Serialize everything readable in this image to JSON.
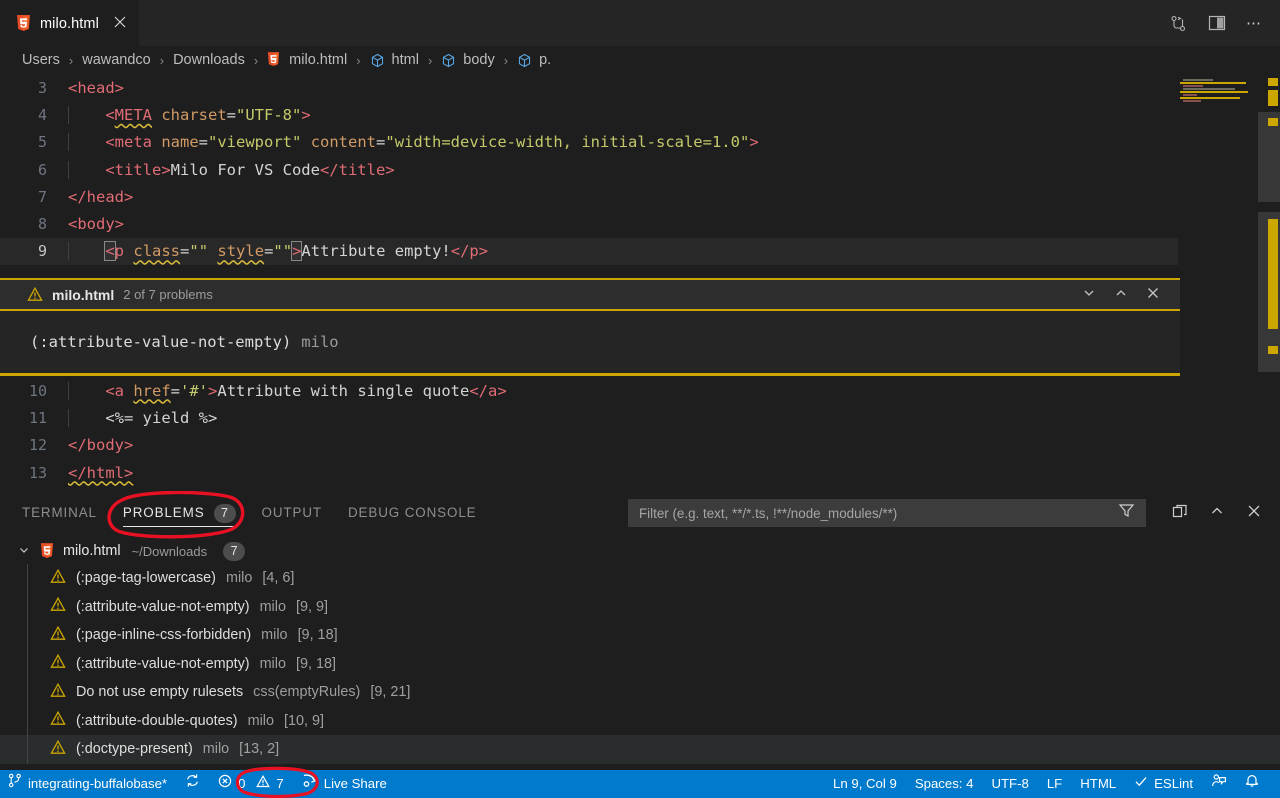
{
  "window": {
    "tab": {
      "label": "milo.html",
      "icon": "html5-icon",
      "close_icon": "close-icon"
    },
    "actions": [
      "source-control-icon",
      "split-editor-icon",
      "more-actions-icon"
    ]
  },
  "breadcrumb": {
    "items": [
      {
        "label": "Users",
        "icon": ""
      },
      {
        "label": "wawandco",
        "icon": ""
      },
      {
        "label": "Downloads",
        "icon": ""
      },
      {
        "label": "milo.html",
        "icon": "html5-icon"
      },
      {
        "label": "html",
        "icon": "symbol-cube-icon"
      },
      {
        "label": "body",
        "icon": "symbol-cube-icon"
      },
      {
        "label": "p.",
        "icon": "symbol-cube-icon"
      }
    ],
    "separator": "›"
  },
  "editor": {
    "lines_top": [
      {
        "num": "3",
        "tokens": [
          {
            "t": "<head>",
            "c": "t-tag"
          }
        ]
      },
      {
        "num": "4",
        "indent": true,
        "tokens": [
          {
            "t": "    ",
            "c": "t-txt"
          },
          {
            "t": "<",
            "c": "t-tag"
          },
          {
            "t": "META",
            "c": "t-tag squiggle"
          },
          {
            "t": " ",
            "c": "t-txt"
          },
          {
            "t": "charset",
            "c": "t-attr"
          },
          {
            "t": "=",
            "c": "t-txt"
          },
          {
            "t": "\"UTF-8\"",
            "c": "t-str"
          },
          {
            "t": ">",
            "c": "t-tag"
          }
        ]
      },
      {
        "num": "5",
        "indent": true,
        "tokens": [
          {
            "t": "    ",
            "c": "t-txt"
          },
          {
            "t": "<meta",
            "c": "t-tag"
          },
          {
            "t": " ",
            "c": "t-txt"
          },
          {
            "t": "name",
            "c": "t-attr"
          },
          {
            "t": "=",
            "c": "t-txt"
          },
          {
            "t": "\"viewport\"",
            "c": "t-str"
          },
          {
            "t": " ",
            "c": "t-txt"
          },
          {
            "t": "content",
            "c": "t-attr"
          },
          {
            "t": "=",
            "c": "t-txt"
          },
          {
            "t": "\"width=device-width, initial-scale=1.0\"",
            "c": "t-str"
          },
          {
            "t": ">",
            "c": "t-tag"
          }
        ]
      },
      {
        "num": "6",
        "indent": true,
        "tokens": [
          {
            "t": "    ",
            "c": "t-txt"
          },
          {
            "t": "<title>",
            "c": "t-tag"
          },
          {
            "t": "Milo For VS Code",
            "c": "t-txt"
          },
          {
            "t": "</title>",
            "c": "t-tag"
          }
        ]
      },
      {
        "num": "7",
        "tokens": [
          {
            "t": "</head>",
            "c": "t-tag"
          }
        ]
      },
      {
        "num": "8",
        "tokens": [
          {
            "t": "<body>",
            "c": "t-tag"
          }
        ]
      },
      {
        "num": "9",
        "active": true,
        "indent": true,
        "tokens": [
          {
            "t": "    ",
            "c": "t-txt"
          },
          {
            "t": "<",
            "c": "t-tag bracket-box"
          },
          {
            "t": "p",
            "c": "t-tag"
          },
          {
            "t": " ",
            "c": "t-txt"
          },
          {
            "t": "class",
            "c": "t-attr squiggle"
          },
          {
            "t": "=",
            "c": "t-txt"
          },
          {
            "t": "\"\"",
            "c": "t-str"
          },
          {
            "t": " ",
            "c": "t-txt"
          },
          {
            "t": "style",
            "c": "t-attr squiggle"
          },
          {
            "t": "=",
            "c": "t-txt"
          },
          {
            "t": "\"\"",
            "c": "t-str"
          },
          {
            "t": ">",
            "c": "t-tag bracket-box"
          },
          {
            "t": "Attribute empty!",
            "c": "t-txt"
          },
          {
            "t": "</p>",
            "c": "t-tag"
          }
        ]
      }
    ],
    "lines_bottom": [
      {
        "num": "10",
        "indent": true,
        "tokens": [
          {
            "t": "    ",
            "c": "t-txt"
          },
          {
            "t": "<a",
            "c": "t-tag"
          },
          {
            "t": " ",
            "c": "t-txt"
          },
          {
            "t": "href",
            "c": "t-attr squiggle"
          },
          {
            "t": "=",
            "c": "t-txt"
          },
          {
            "t": "'#'",
            "c": "t-str"
          },
          {
            "t": ">",
            "c": "t-tag"
          },
          {
            "t": "Attribute with single quote",
            "c": "t-txt"
          },
          {
            "t": "</a>",
            "c": "t-tag"
          }
        ]
      },
      {
        "num": "11",
        "indent": true,
        "tokens": [
          {
            "t": "    ",
            "c": "t-txt"
          },
          {
            "t": "<%= yield %>",
            "c": "t-erb"
          }
        ]
      },
      {
        "num": "12",
        "tokens": [
          {
            "t": "</body>",
            "c": "t-tag"
          }
        ]
      },
      {
        "num": "13",
        "tokens": [
          {
            "t": "</html>",
            "c": "t-tag squiggle"
          }
        ]
      }
    ]
  },
  "peek": {
    "warning_icon": "warning-triangle-icon",
    "file": "milo.html",
    "count_label": "2 of 7 problems",
    "message": "(:attribute-value-not-empty)",
    "source": "milo",
    "actions": [
      "chevron-down-icon",
      "chevron-up-icon",
      "close-icon"
    ]
  },
  "panel": {
    "tabs": [
      {
        "label": "TERMINAL",
        "active": false,
        "badge": null
      },
      {
        "label": "PROBLEMS",
        "active": true,
        "badge": "7"
      },
      {
        "label": "OUTPUT",
        "active": false,
        "badge": null
      },
      {
        "label": "DEBUG CONSOLE",
        "active": false,
        "badge": null
      }
    ],
    "filter": {
      "value": "",
      "placeholder": "Filter (e.g. text, **/*.ts, !**/node_modules/**)",
      "icon": "filter-icon"
    },
    "actions": [
      "split-panel-icon",
      "chevron-up-icon",
      "close-icon"
    ],
    "file_group": {
      "collapse_icon": "chevron-down-icon",
      "file_icon": "html5-icon",
      "name": "milo.html",
      "path": "~/Downloads",
      "badge": "7"
    },
    "problems": [
      {
        "icon": "warning-triangle-icon",
        "message": "(:page-tag-lowercase)",
        "source": "milo",
        "location": "[4, 6]",
        "hover": false
      },
      {
        "icon": "warning-triangle-icon",
        "message": "(:attribute-value-not-empty)",
        "source": "milo",
        "location": "[9, 9]",
        "hover": false
      },
      {
        "icon": "warning-triangle-icon",
        "message": "(:page-inline-css-forbidden)",
        "source": "milo",
        "location": "[9, 18]",
        "hover": false
      },
      {
        "icon": "warning-triangle-icon",
        "message": "(:attribute-value-not-empty)",
        "source": "milo",
        "location": "[9, 18]",
        "hover": false
      },
      {
        "icon": "warning-triangle-icon",
        "message": "Do not use empty rulesets",
        "source": "css(emptyRules)",
        "location": "[9, 21]",
        "hover": false
      },
      {
        "icon": "warning-triangle-icon",
        "message": "(:attribute-double-quotes)",
        "source": "milo",
        "location": "[10, 9]",
        "hover": false
      },
      {
        "icon": "warning-triangle-icon",
        "message": "(:doctype-present)",
        "source": "milo",
        "location": "[13, 2]",
        "hover": true
      }
    ]
  },
  "statusbar": {
    "background": "#007acc",
    "left": [
      {
        "icon": "source-control-branch-icon",
        "label": "integrating-buffalobase*"
      },
      {
        "icon": "sync-icon",
        "label": ""
      },
      {
        "icon": "error-warning-icon",
        "label": "0",
        "label2": "7"
      },
      {
        "icon": "live-share-icon",
        "label": "Live Share"
      }
    ],
    "right": [
      {
        "label": "Ln 9, Col 9"
      },
      {
        "label": "Spaces: 4"
      },
      {
        "label": "UTF-8"
      },
      {
        "label": "LF"
      },
      {
        "label": "HTML"
      },
      {
        "icon": "check-icon",
        "label": "ESLint"
      },
      {
        "icon": "feedback-icon",
        "label": ""
      },
      {
        "icon": "bell-icon",
        "label": ""
      }
    ]
  },
  "annotations": {
    "color": "#e81123",
    "shapes": [
      "ellipse-around-problems-tab",
      "ellipse-around-status-counts"
    ]
  }
}
